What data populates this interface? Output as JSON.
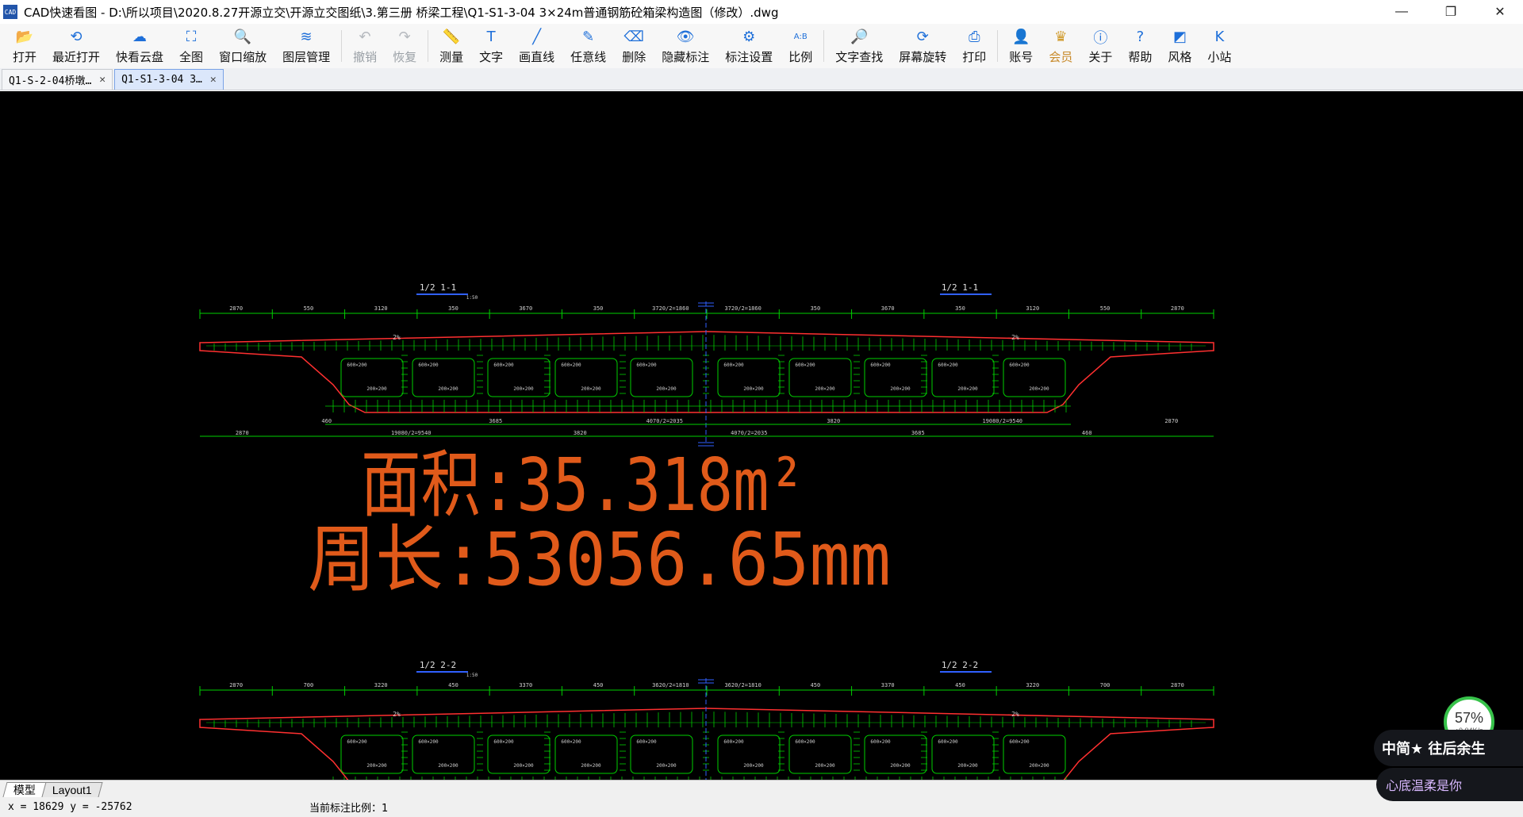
{
  "window": {
    "icon_text": "CAD",
    "title": "CAD快速看图 - D:\\所以项目\\2020.8.27开源立交\\开源立交图纸\\3.第三册 桥梁工程\\Q1-S1-3-04 3×24m普通钢筋砼箱梁构造图（修改）.dwg",
    "minimize": "—",
    "maximize": "❐",
    "close": "✕"
  },
  "toolbar": [
    {
      "label": "打开",
      "icon": "folder-open-icon"
    },
    {
      "label": "最近打开",
      "icon": "recent-icon"
    },
    {
      "label": "快看云盘",
      "icon": "cloud-icon"
    },
    {
      "label": "全图",
      "icon": "full-view-icon"
    },
    {
      "label": "窗口缩放",
      "icon": "window-zoom-icon"
    },
    {
      "label": "图层管理",
      "icon": "layers-icon"
    },
    {
      "label": "撤销",
      "icon": "undo-icon",
      "disabled": true
    },
    {
      "label": "恢复",
      "icon": "redo-icon",
      "disabled": true
    },
    {
      "label": "测量",
      "icon": "ruler-icon"
    },
    {
      "label": "文字",
      "icon": "text-icon"
    },
    {
      "label": "画直线",
      "icon": "line-icon"
    },
    {
      "label": "任意线",
      "icon": "freehand-icon"
    },
    {
      "label": "删除",
      "icon": "eraser-icon"
    },
    {
      "label": "隐藏标注",
      "icon": "eye-icon"
    },
    {
      "label": "标注设置",
      "icon": "dimension-settings-icon"
    },
    {
      "label": "比例",
      "icon": "scale-icon"
    },
    {
      "label": "文字查找",
      "icon": "text-search-icon"
    },
    {
      "label": "屏幕旋转",
      "icon": "rotate-icon"
    },
    {
      "label": "打印",
      "icon": "printer-icon"
    },
    {
      "label": "账号",
      "icon": "user-icon"
    },
    {
      "label": "会员",
      "icon": "vip-icon",
      "vip": true
    },
    {
      "label": "关于",
      "icon": "info-icon"
    },
    {
      "label": "帮助",
      "icon": "help-icon"
    },
    {
      "label": "风格",
      "icon": "style-icon"
    },
    {
      "label": "小站",
      "icon": "station-icon"
    }
  ],
  "tabs": [
    {
      "label": "Q1-S-2-04桥墩…",
      "active": false
    },
    {
      "label": "Q1-S1-3-04 3…",
      "active": true
    }
  ],
  "tab_close": "✕",
  "drawing": {
    "area_label": "面积:35.318m²",
    "perimeter_label": "周长:53056.65mm",
    "section1_left": "1/2  1-1",
    "section1_right": "1/2  1-1",
    "section2_left": "1/2  2-2",
    "section2_right": "1/2  2-2",
    "scale_mark": "1:50",
    "dims_top_1": [
      "2870",
      "550",
      "3120",
      "350",
      "3670",
      "350",
      "3720/2=1860",
      "3720/2=1860",
      "350",
      "3670",
      "350",
      "3120",
      "550",
      "2870"
    ],
    "dims_bottom_1": [
      "2870",
      "460",
      "19080/2=9540",
      "3685",
      "3820",
      "4070/2=2035",
      "4070/2=2035",
      "3820",
      "3685",
      "19080/2=9540",
      "460",
      "2870"
    ],
    "slope": "2%",
    "cells": [
      "600×200",
      "200×200"
    ],
    "dims_top_2": [
      "2870",
      "700",
      "3220",
      "450",
      "3370",
      "450",
      "3620/2=1810",
      "3620/2=1810",
      "450",
      "3370",
      "450",
      "3220",
      "700",
      "2870"
    ]
  },
  "layouts": [
    "模型",
    "Layout1"
  ],
  "status": {
    "coords": "x = 18629  y = -25762",
    "scale": "当前标注比例：1"
  },
  "widgets": {
    "speed_percent": "57%",
    "speed_rate": "↑0.04K/s",
    "ime_text": "中简★ 往后余生",
    "ime_text2": "心底温柔是你"
  },
  "colors": {
    "canvas_bg": "#000000",
    "green": "#00d000",
    "red": "#ff3030",
    "orange": "#e05a1a",
    "blue": "#3060ff"
  }
}
